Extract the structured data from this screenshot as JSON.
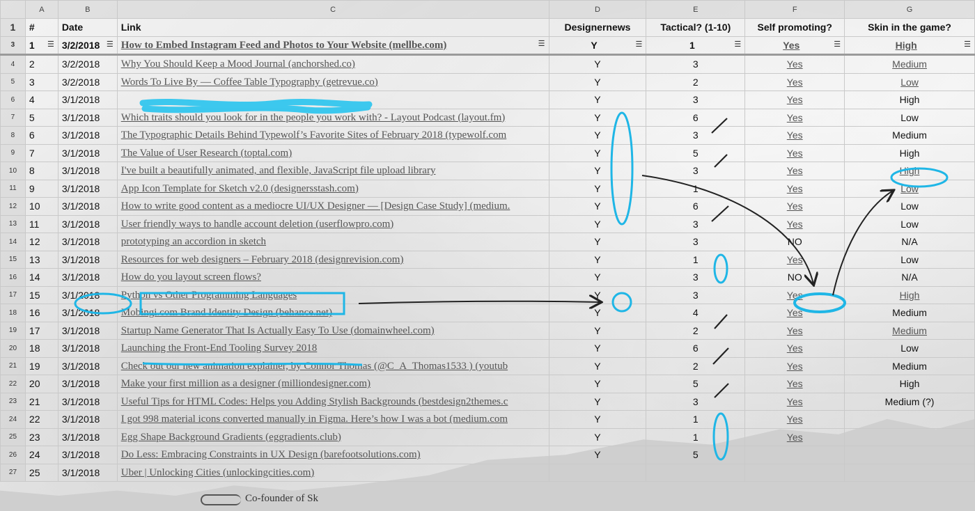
{
  "columns": [
    "A",
    "B",
    "C",
    "D",
    "E",
    "F",
    "G"
  ],
  "headers": {
    "num": "#",
    "date": "Date",
    "link": "Link",
    "designernews": "Designernews",
    "tactical": "Tactical? (1-10)",
    "self_promoting": "Self promoting?",
    "skin": "Skin in the game?"
  },
  "row_numbers": [
    "1",
    "3",
    "4",
    "5",
    "6",
    "7",
    "8",
    "9",
    "10",
    "11",
    "12",
    "13",
    "14",
    "15",
    "16",
    "17",
    "18",
    "19",
    "20",
    "21",
    "22",
    "23",
    "24",
    "25",
    "26",
    "27"
  ],
  "rows": [
    {
      "num": "1",
      "date": "3/2/2018",
      "link": "How to Embed Instagram Feed and Photos to Your Website (mellbe.com)",
      "dn": "Y",
      "tac": "1",
      "self": "Yes",
      "skin": "High"
    },
    {
      "num": "2",
      "date": "3/2/2018",
      "link": "Why You Should Keep a Mood Journal (anchorshed.co)",
      "dn": "Y",
      "tac": "3",
      "self": "Yes",
      "skin": "Medium"
    },
    {
      "num": "3",
      "date": "3/2/2018",
      "link": "Words To Live By — Coffee Table Typography (getrevue.co)",
      "dn": "Y",
      "tac": "2",
      "self": "Yes",
      "skin": "Low"
    },
    {
      "num": "4",
      "date": "3/1/2018",
      "link": "",
      "dn": "Y",
      "tac": "3",
      "self": "Yes",
      "skin": "High"
    },
    {
      "num": "5",
      "date": "3/1/2018",
      "link": "Which traits should you look for in the people you work with? - Layout Podcast (layout.fm)",
      "dn": "Y",
      "tac": "6",
      "self": "Yes",
      "skin": "Low"
    },
    {
      "num": "6",
      "date": "3/1/2018",
      "link": "The Typographic Details Behind Typewolf’s Favorite Sites of February 2018 (typewolf.com",
      "dn": "Y",
      "tac": "3",
      "self": "Yes",
      "skin": "Medium"
    },
    {
      "num": "7",
      "date": "3/1/2018",
      "link": "The Value of User Research (toptal.com)",
      "dn": "Y",
      "tac": "5",
      "self": "Yes",
      "skin": "High"
    },
    {
      "num": "8",
      "date": "3/1/2018",
      "link": "I've built a beautifully animated, and flexible, JavaScript file upload library",
      "dn": "Y",
      "tac": "3",
      "self": "Yes",
      "skin": "High"
    },
    {
      "num": "9",
      "date": "3/1/2018",
      "link": "App Icon Template for Sketch v2.0 (designersstash.com)",
      "dn": "Y",
      "tac": "1",
      "self": "Yes",
      "skin": "Low"
    },
    {
      "num": "10",
      "date": "3/1/2018",
      "link": "How to write good content as a mediocre UI/UX Designer — [Design Case Study] (medium.",
      "dn": "Y",
      "tac": "6",
      "self": "Yes",
      "skin": "Low"
    },
    {
      "num": "11",
      "date": "3/1/2018",
      "link": "User friendly ways to handle account deletion (userflowpro.com)",
      "dn": "Y",
      "tac": "3",
      "self": "Yes",
      "skin": "Low"
    },
    {
      "num": "12",
      "date": "3/1/2018",
      "link": "prototyping an accordion in sketch",
      "dn": "Y",
      "tac": "3",
      "self": "NO",
      "skin": "N/A"
    },
    {
      "num": "13",
      "date": "3/1/2018",
      "link": "Resources for web designers – February 2018 (designrevision.com)",
      "dn": "Y",
      "tac": "1",
      "self": "Yes",
      "skin": "Low"
    },
    {
      "num": "14",
      "date": "3/1/2018",
      "link": "How do you layout screen flows?",
      "dn": "Y",
      "tac": "3",
      "self": "NO",
      "skin": "N/A"
    },
    {
      "num": "15",
      "date": "3/1/2018",
      "link": "Python vs Other Programming Languages",
      "dn": "Y",
      "tac": "3",
      "self": "Yes",
      "skin": "High"
    },
    {
      "num": "16",
      "date": "3/1/2018",
      "link": "Mobingi.com Brand Identity Design (behance.net)",
      "dn": "Y",
      "tac": "4",
      "self": "Yes",
      "skin": "Medium"
    },
    {
      "num": "17",
      "date": "3/1/2018",
      "link": "Startup Name Generator That Is Actually Easy To Use (domainwheel.com)",
      "dn": "Y",
      "tac": "2",
      "self": "Yes",
      "skin": "Medium"
    },
    {
      "num": "18",
      "date": "3/1/2018",
      "link": "Launching the Front-End Tooling Survey 2018",
      "dn": "Y",
      "tac": "6",
      "self": "Yes",
      "skin": "Low"
    },
    {
      "num": "19",
      "date": "3/1/2018",
      "link": "Check out our new animation explainer, by Connor Thomas (@C_A_Thomas1533 ) (youtub",
      "dn": "Y",
      "tac": "2",
      "self": "Yes",
      "skin": "Medium"
    },
    {
      "num": "20",
      "date": "3/1/2018",
      "link": "Make your first million as a designer (milliondesigner.com)",
      "dn": "Y",
      "tac": "5",
      "self": "Yes",
      "skin": "High"
    },
    {
      "num": "21",
      "date": "3/1/2018",
      "link": "Useful Tips for HTML Codes: Helps you Adding Stylish Backgrounds (bestdesign2themes.c",
      "dn": "Y",
      "tac": "3",
      "self": "Yes",
      "skin": "Medium (?)"
    },
    {
      "num": "22",
      "date": "3/1/2018",
      "link": "I got 998 material icons converted manually in Figma. Here’s how I was a bot (medium.com",
      "dn": "Y",
      "tac": "1",
      "self": "Yes",
      "skin": ""
    },
    {
      "num": "23",
      "date": "3/1/2018",
      "link": "Egg Shape Background Gradients (eggradients.club)",
      "dn": "Y",
      "tac": "1",
      "self": "Yes",
      "skin": ""
    },
    {
      "num": "24",
      "date": "3/1/2018",
      "link": "Do Less: Embracing Constraints in UX Design (barefootsolutions.com)",
      "dn": "Y",
      "tac": "5",
      "self": "",
      "skin": ""
    },
    {
      "num": "25",
      "date": "3/1/2018",
      "link": "Uber | Unlocking Cities (unlockingcities.com)",
      "dn": "",
      "tac": "",
      "self": "",
      "skin": ""
    }
  ],
  "footer": {
    "text": "Co-founder of Sk"
  },
  "annotation_color": "#1fb6e6"
}
